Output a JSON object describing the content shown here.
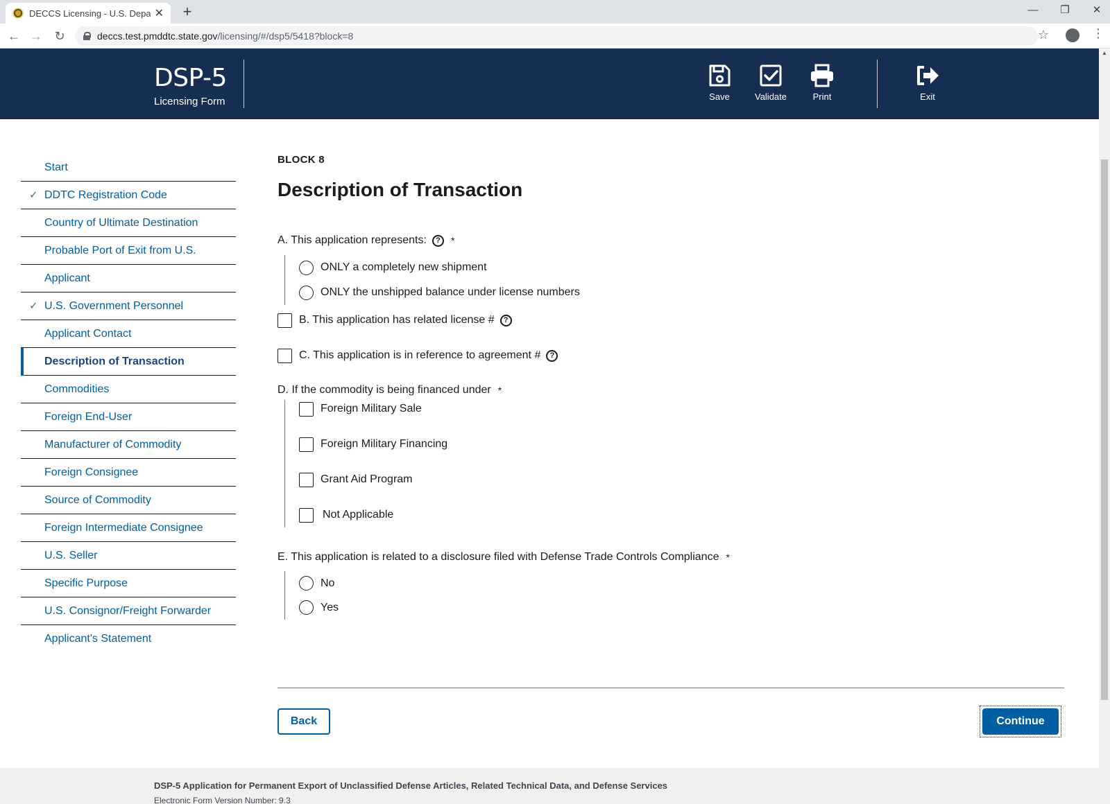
{
  "browser": {
    "tab_title": "DECCS Licensing - U.S. Department",
    "url_host": "deccs.test.pmddtc.state.gov",
    "url_path": "/licensing/#/dsp5/5418?block=8"
  },
  "header": {
    "title": "DSP-5",
    "subtitle": "Licensing Form",
    "buttons": {
      "save": "Save",
      "validate": "Validate",
      "print": "Print",
      "exit": "Exit"
    }
  },
  "sidebar": {
    "items": [
      {
        "label": "Start",
        "status": ""
      },
      {
        "label": "DDTC Registration Code",
        "status": "complete"
      },
      {
        "label": "Country of Ultimate Destination",
        "status": ""
      },
      {
        "label": "Probable Port of Exit from U.S.",
        "status": ""
      },
      {
        "label": "Applicant",
        "status": ""
      },
      {
        "label": "U.S. Government Personnel",
        "status": "complete"
      },
      {
        "label": "Applicant Contact",
        "status": ""
      },
      {
        "label": "Description of Transaction",
        "status": "current"
      },
      {
        "label": "Commodities",
        "status": ""
      },
      {
        "label": "Foreign End-User",
        "status": ""
      },
      {
        "label": "Manufacturer of Commodity",
        "status": ""
      },
      {
        "label": "Foreign Consignee",
        "status": ""
      },
      {
        "label": "Source of Commodity",
        "status": ""
      },
      {
        "label": "Foreign Intermediate Consignee",
        "status": ""
      },
      {
        "label": "U.S. Seller",
        "status": ""
      },
      {
        "label": "Specific Purpose",
        "status": ""
      },
      {
        "label": "U.S. Consignor/Freight Forwarder",
        "status": ""
      },
      {
        "label": "Applicant's Statement",
        "status": ""
      }
    ]
  },
  "form": {
    "block_label": "BLOCK 8",
    "title": "Description of Transaction",
    "question_a": {
      "label": "A. This application represents:",
      "required": "*",
      "options": [
        "ONLY a completely new shipment",
        "ONLY the unshipped balance under license numbers"
      ]
    },
    "question_b": {
      "label": "B. This application has related license #"
    },
    "question_c": {
      "label": "C. This application is in reference to agreement #"
    },
    "question_d": {
      "label": "D. If the commodity is being financed under",
      "required": "*",
      "options": [
        "Foreign Military Sale",
        "Foreign Military Financing",
        "Grant Aid Program",
        "Not Applicable"
      ]
    },
    "question_e": {
      "label": "E. This application is related to a disclosure filed with Defense Trade Controls Compliance",
      "required": "*",
      "options": [
        "No",
        "Yes"
      ]
    },
    "back_label": "Back",
    "continue_label": "Continue"
  },
  "footer": {
    "title": "DSP-5 Application for Permanent Export of Unclassified Defense Articles, Related Technical Data, and Defense Services",
    "version": "Electronic Form Version Number: 9.3"
  },
  "colors": {
    "header_bg": "#162e51",
    "link": "#005ea2",
    "check": "#2e8540",
    "button": "#005ea2"
  },
  "icons": [
    "save-icon",
    "validate-icon",
    "print-icon",
    "exit-icon",
    "help-icon",
    "check-icon",
    "lock-icon"
  ]
}
